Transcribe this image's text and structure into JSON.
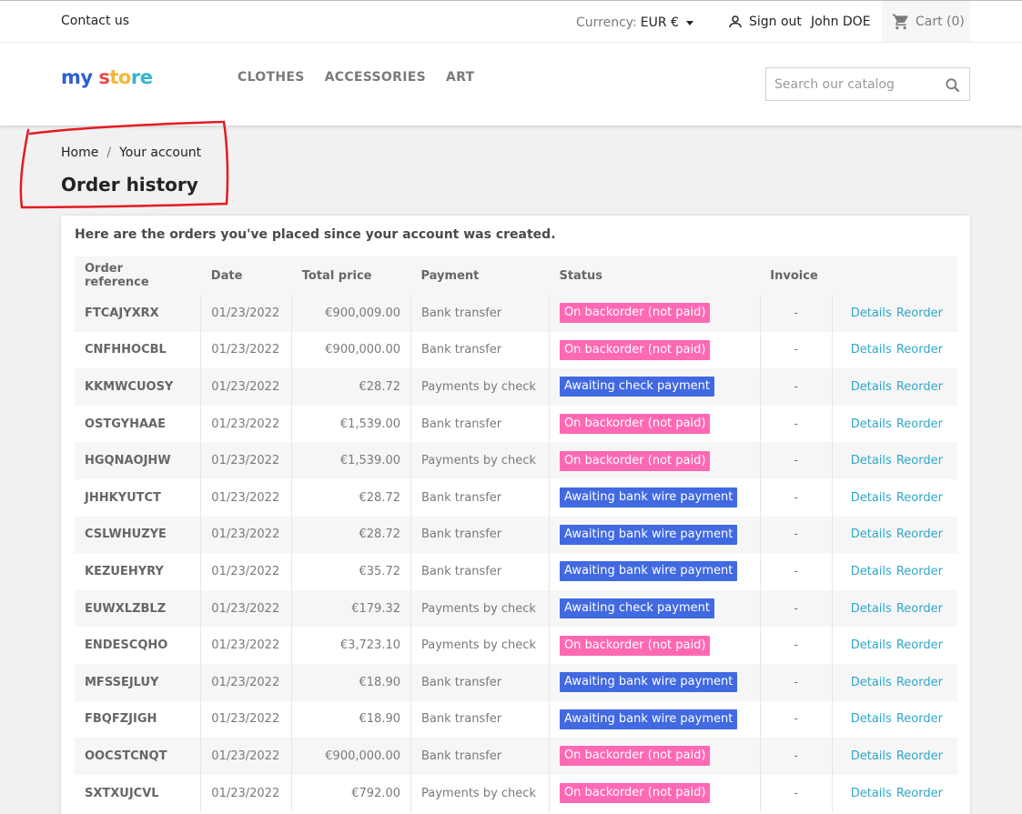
{
  "topnav": {
    "contact": "Contact us",
    "currency_label": "Currency:",
    "currency_value": "EUR €",
    "signout": "Sign out",
    "username": "John DOE",
    "cart": "Cart (0)"
  },
  "header": {
    "logo": {
      "part1": "my",
      "part2": "s",
      "part3": "to",
      "part4": "re"
    },
    "menu": [
      "CLOTHES",
      "ACCESSORIES",
      "ART"
    ],
    "search_placeholder": "Search our catalog"
  },
  "breadcrumb": {
    "home": "Home",
    "sep": "/",
    "current": "Your account"
  },
  "page_title": "Order history",
  "intro": "Here are the orders you've placed since your account was created.",
  "table": {
    "headers": [
      "Order reference",
      "Date",
      "Total price",
      "Payment",
      "Status",
      "Invoice",
      ""
    ],
    "details_label": "Details",
    "reorder_label": "Reorder",
    "rows": [
      {
        "ref": "FTCAJYXRX",
        "date": "01/23/2022",
        "price": "€900,009.00",
        "payment": "Bank transfer",
        "status": "On backorder (not paid)",
        "status_color": "#ff69b4",
        "invoice": "-"
      },
      {
        "ref": "CNFHHOCBL",
        "date": "01/23/2022",
        "price": "€900,000.00",
        "payment": "Bank transfer",
        "status": "On backorder (not paid)",
        "status_color": "#ff69b4",
        "invoice": "-"
      },
      {
        "ref": "KKMWCUOSY",
        "date": "01/23/2022",
        "price": "€28.72",
        "payment": "Payments by check",
        "status": "Awaiting check payment",
        "status_color": "#4169e1",
        "invoice": "-"
      },
      {
        "ref": "OSTGYHAAE",
        "date": "01/23/2022",
        "price": "€1,539.00",
        "payment": "Bank transfer",
        "status": "On backorder (not paid)",
        "status_color": "#ff69b4",
        "invoice": "-"
      },
      {
        "ref": "HGQNAOJHW",
        "date": "01/23/2022",
        "price": "€1,539.00",
        "payment": "Payments by check",
        "status": "On backorder (not paid)",
        "status_color": "#ff69b4",
        "invoice": "-"
      },
      {
        "ref": "JHHKYUTCT",
        "date": "01/23/2022",
        "price": "€28.72",
        "payment": "Bank transfer",
        "status": "Awaiting bank wire payment",
        "status_color": "#4169e1",
        "invoice": "-"
      },
      {
        "ref": "CSLWHUZYE",
        "date": "01/23/2022",
        "price": "€28.72",
        "payment": "Bank transfer",
        "status": "Awaiting bank wire payment",
        "status_color": "#4169e1",
        "invoice": "-"
      },
      {
        "ref": "KEZUEHYRY",
        "date": "01/23/2022",
        "price": "€35.72",
        "payment": "Bank transfer",
        "status": "Awaiting bank wire payment",
        "status_color": "#4169e1",
        "invoice": "-"
      },
      {
        "ref": "EUWXLZBLZ",
        "date": "01/23/2022",
        "price": "€179.32",
        "payment": "Payments by check",
        "status": "Awaiting check payment",
        "status_color": "#4169e1",
        "invoice": "-"
      },
      {
        "ref": "ENDESCQHO",
        "date": "01/23/2022",
        "price": "€3,723.10",
        "payment": "Payments by check",
        "status": "On backorder (not paid)",
        "status_color": "#ff69b4",
        "invoice": "-"
      },
      {
        "ref": "MFSSEJLUY",
        "date": "01/23/2022",
        "price": "€18.90",
        "payment": "Bank transfer",
        "status": "Awaiting bank wire payment",
        "status_color": "#4169e1",
        "invoice": "-"
      },
      {
        "ref": "FBQFZJIGH",
        "date": "01/23/2022",
        "price": "€18.90",
        "payment": "Bank transfer",
        "status": "Awaiting bank wire payment",
        "status_color": "#4169e1",
        "invoice": "-"
      },
      {
        "ref": "OOCSTCNQT",
        "date": "01/23/2022",
        "price": "€900,000.00",
        "payment": "Bank transfer",
        "status": "On backorder (not paid)",
        "status_color": "#ff69b4",
        "invoice": "-"
      },
      {
        "ref": "SXTXUJCVL",
        "date": "01/23/2022",
        "price": "€792.00",
        "payment": "Payments by check",
        "status": "On backorder (not paid)",
        "status_color": "#ff69b4",
        "invoice": "-"
      }
    ]
  },
  "colors": {
    "accent": "#2fb5d2",
    "link": "#2fa7c9",
    "annotation": "#e31b23"
  }
}
